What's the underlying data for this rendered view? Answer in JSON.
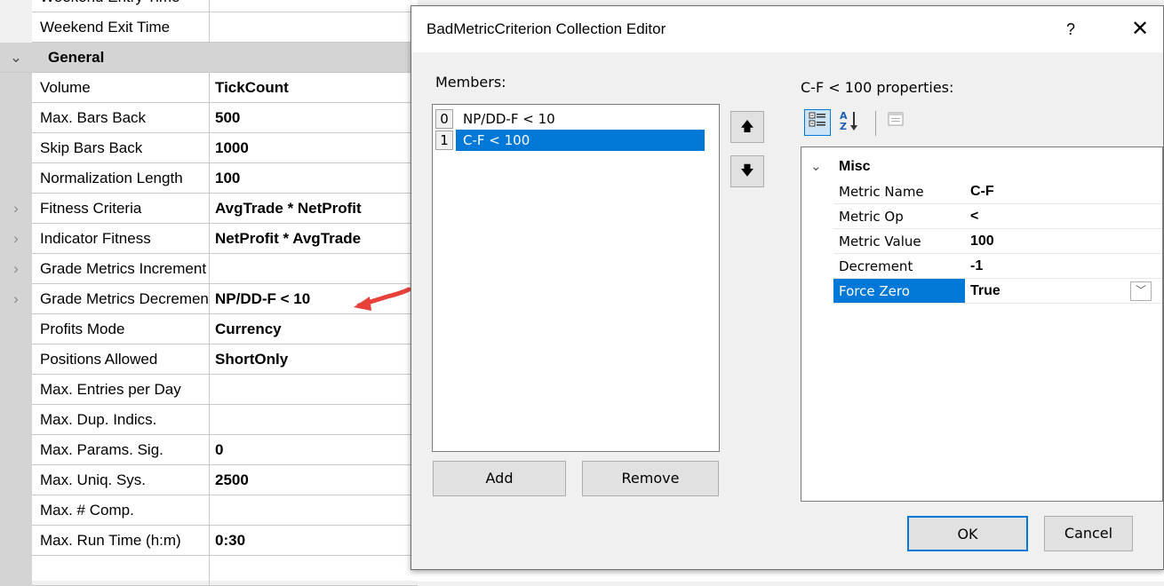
{
  "grid": {
    "partial_row_top": "Weekend Entry Time",
    "rows": [
      {
        "name": "Weekend Exit Time",
        "value": ""
      },
      {
        "name": "Volume",
        "value": "TickCount"
      },
      {
        "name": "Max. Bars Back",
        "value": "500"
      },
      {
        "name": "Skip Bars Back",
        "value": "1000"
      },
      {
        "name": "Normalization Length",
        "value": "100"
      },
      {
        "name": "Fitness Criteria",
        "value": "AvgTrade * NetProfit"
      },
      {
        "name": "Indicator Fitness",
        "value": "NetProfit * AvgTrade"
      },
      {
        "name": "Grade Metrics Increment",
        "value": ""
      },
      {
        "name": "Grade Metrics Decrement",
        "value": "NP/DD-F < 10"
      },
      {
        "name": "Profits Mode",
        "value": "Currency"
      },
      {
        "name": "Positions Allowed",
        "value": "ShortOnly"
      },
      {
        "name": "Max. Entries per Day",
        "value": ""
      },
      {
        "name": "Max. Dup. Indics.",
        "value": ""
      },
      {
        "name": "Max. Params. Sig.",
        "value": "0"
      },
      {
        "name": "Max. Uniq. Sys.",
        "value": "2500"
      },
      {
        "name": "Max. # Comp.",
        "value": ""
      },
      {
        "name": "Max. Run Time (h:m)",
        "value": "0:30"
      }
    ],
    "category": "General"
  },
  "dialog": {
    "title": "BadMetricCriterion Collection Editor",
    "help": "?",
    "close": "✕",
    "members_label": "Members:",
    "members": [
      {
        "index": "0",
        "text": "NP/DD-F < 10"
      },
      {
        "index": "1",
        "text": "C-F < 100"
      }
    ],
    "move_up": "🡅",
    "move_down": "🡇",
    "add_label": "Add",
    "remove_label": "Remove",
    "properties_label": "C-F < 100 properties:",
    "section": "Misc",
    "properties": [
      {
        "name": "Metric Name",
        "value": "C-F"
      },
      {
        "name": "Metric Op",
        "value": "<"
      },
      {
        "name": "Metric Value",
        "value": "100"
      },
      {
        "name": "Decrement",
        "value": "-1"
      },
      {
        "name": "Force Zero",
        "value": "True"
      }
    ],
    "ok_label": "OK",
    "cancel_label": "Cancel"
  },
  "colors": {
    "selection": "#0078d7",
    "arrow": "#e8413c"
  }
}
